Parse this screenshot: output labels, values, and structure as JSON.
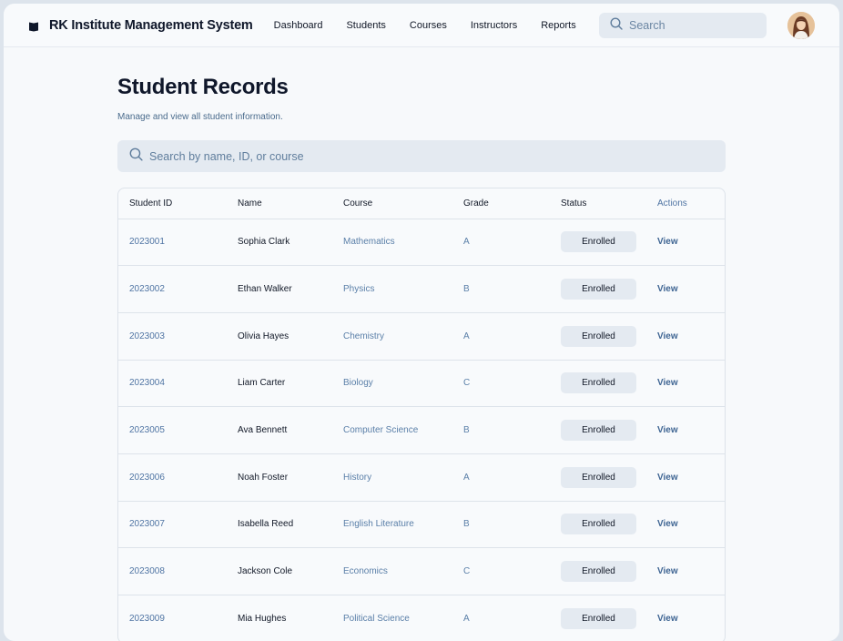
{
  "header": {
    "app_title": "RK Institute Management System",
    "nav": [
      "Dashboard",
      "Students",
      "Courses",
      "Instructors",
      "Reports"
    ],
    "search_placeholder": "Search"
  },
  "main": {
    "title": "Student Records",
    "subtitle": "Manage and view all student information.",
    "search_placeholder": "Search by name, ID, or course",
    "columns": [
      "Student ID",
      "Name",
      "Course",
      "Grade",
      "Status",
      "Actions"
    ],
    "rows": [
      {
        "id": "2023001",
        "name": "Sophia Clark",
        "course": "Mathematics",
        "grade": "A",
        "status": "Enrolled",
        "action": "View"
      },
      {
        "id": "2023002",
        "name": "Ethan Walker",
        "course": "Physics",
        "grade": "B",
        "status": "Enrolled",
        "action": "View"
      },
      {
        "id": "2023003",
        "name": "Olivia Hayes",
        "course": "Chemistry",
        "grade": "A",
        "status": "Enrolled",
        "action": "View"
      },
      {
        "id": "2023004",
        "name": "Liam Carter",
        "course": "Biology",
        "grade": "C",
        "status": "Enrolled",
        "action": "View"
      },
      {
        "id": "2023005",
        "name": "Ava Bennett",
        "course": "Computer Science",
        "grade": "B",
        "status": "Enrolled",
        "action": "View"
      },
      {
        "id": "2023006",
        "name": "Noah Foster",
        "course": "History",
        "grade": "A",
        "status": "Enrolled",
        "action": "View"
      },
      {
        "id": "2023007",
        "name": "Isabella Reed",
        "course": "English Literature",
        "grade": "B",
        "status": "Enrolled",
        "action": "View"
      },
      {
        "id": "2023008",
        "name": "Jackson Cole",
        "course": "Economics",
        "grade": "C",
        "status": "Enrolled",
        "action": "View"
      },
      {
        "id": "2023009",
        "name": "Mia Hughes",
        "course": "Political Science",
        "grade": "A",
        "status": "Enrolled",
        "action": "View"
      }
    ]
  },
  "icons": {
    "brand": "book-icon",
    "search": "search-icon",
    "avatar": "user-avatar"
  },
  "colors": {
    "accent": "#4f74a3",
    "badge_bg": "#e4eaf1",
    "page_bg": "#f7f9fb"
  }
}
